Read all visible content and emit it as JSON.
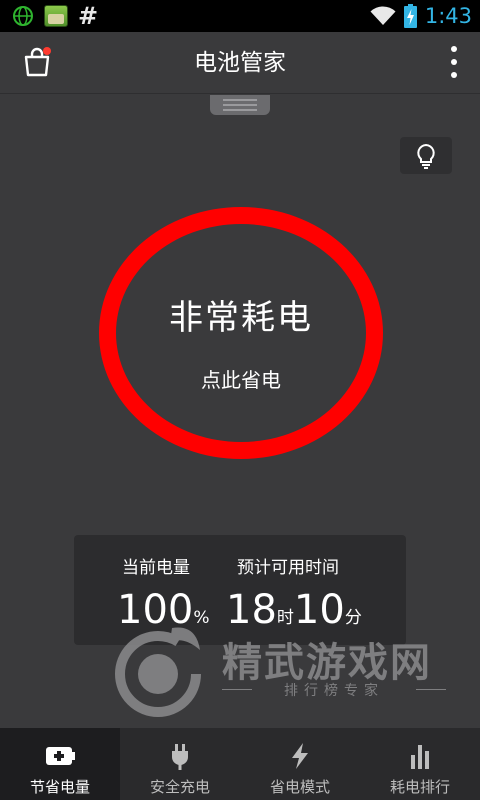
{
  "status_bar": {
    "left_icons": [
      "globe-icon",
      "app-icon",
      "hash-icon"
    ],
    "hash_symbol": "#",
    "right_icons": [
      "wifi-icon",
      "battery-charging-icon"
    ],
    "time": "1:43",
    "time_color": "#33b5e5"
  },
  "action_bar": {
    "title": "电池管家",
    "left_icon": "shopping-bag-icon",
    "right_icon": "more-vert-icon"
  },
  "main": {
    "tip_icon": "lightbulb-icon",
    "ring_color": "#ff0000",
    "status": "非常耗电",
    "action": "点此省电",
    "info": {
      "battery_label": "当前电量",
      "battery_value": "100",
      "battery_unit": "%",
      "remaining_label": "预计可用时间",
      "hours_value": "18",
      "hours_unit": "时",
      "minutes_value": "10",
      "minutes_unit": "分"
    }
  },
  "watermark": {
    "title": "精武游戏网",
    "subtitle": "排行榜专家"
  },
  "tabs": [
    {
      "label": "节省电量",
      "icon": "battery-plus-icon",
      "active": true
    },
    {
      "label": "安全充电",
      "icon": "plug-icon",
      "active": false
    },
    {
      "label": "省电模式",
      "icon": "lightning-icon",
      "active": false
    },
    {
      "label": "耗电排行",
      "icon": "bar-chart-icon",
      "active": false
    }
  ]
}
